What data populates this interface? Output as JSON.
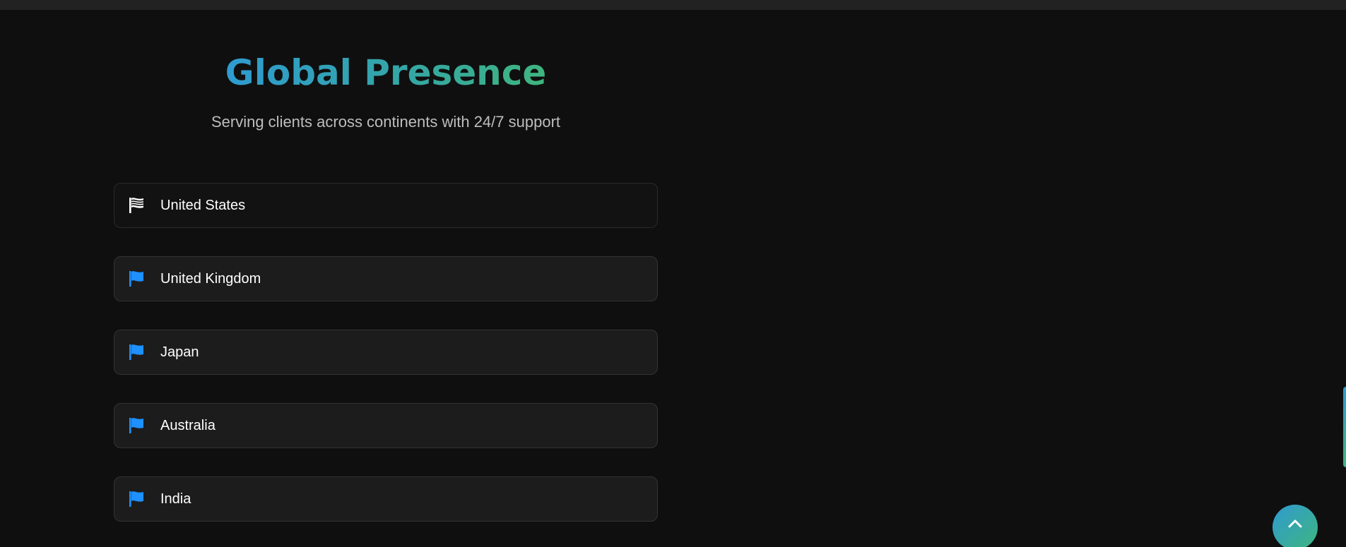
{
  "section": {
    "title": "Global Presence",
    "subtitle": "Serving clients across continents with 24/7 support"
  },
  "countries": [
    {
      "label": "United States",
      "icon": "waving-flag-icon",
      "active": true
    },
    {
      "label": "United Kingdom",
      "icon": "flag-icon",
      "active": false
    },
    {
      "label": "Japan",
      "icon": "flag-icon",
      "active": false
    },
    {
      "label": "Australia",
      "icon": "flag-icon",
      "active": false
    },
    {
      "label": "India",
      "icon": "flag-icon",
      "active": false
    }
  ],
  "scroll_top": {
    "icon": "chevron-up-icon"
  },
  "colors": {
    "background": "#0f0f0f",
    "accent_blue": "#2f9bd0",
    "accent_green": "#3fb57f",
    "flag_blue": "#1e90ff",
    "item_bg": "#1c1c1c"
  }
}
